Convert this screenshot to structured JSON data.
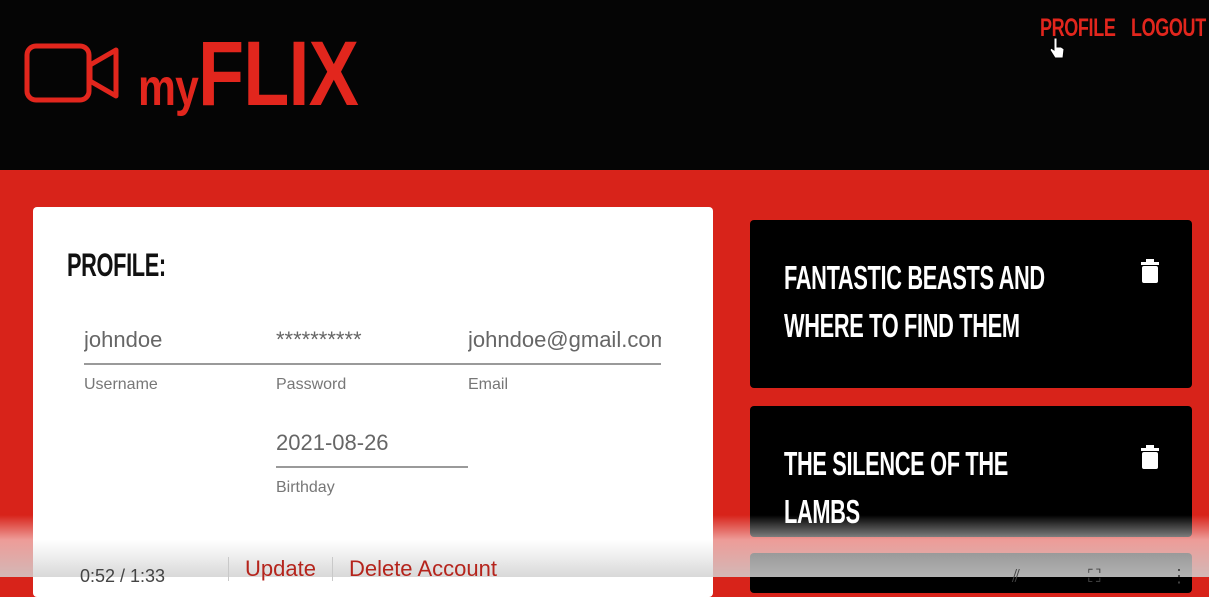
{
  "header": {
    "logo": {
      "my": "my",
      "flix": "FLIX"
    },
    "nav": {
      "profile": "PROFILE",
      "logout": "LOGOUT"
    }
  },
  "profile_card": {
    "title": "PROFILE:",
    "fields": {
      "username": {
        "value": "johndoe",
        "helper": "Username"
      },
      "password": {
        "value": "**********",
        "helper": "Password"
      },
      "email": {
        "value": "johndoe@gmail.com",
        "helper": "Email"
      },
      "birthday": {
        "value": "2021-08-26",
        "helper": "Birthday"
      }
    },
    "actions": {
      "update": "Update",
      "delete": "Delete Account"
    }
  },
  "favorites": [
    {
      "title": "FANTASTIC BEASTS AND WHERE TO FIND THEM"
    },
    {
      "title": "THE SILENCE OF THE LAMBS"
    }
  ],
  "player": {
    "time": "0:52 / 1:33"
  },
  "colors": {
    "brand_red": "#e2261d",
    "background_red": "#d8231a",
    "header_black": "#050505"
  }
}
